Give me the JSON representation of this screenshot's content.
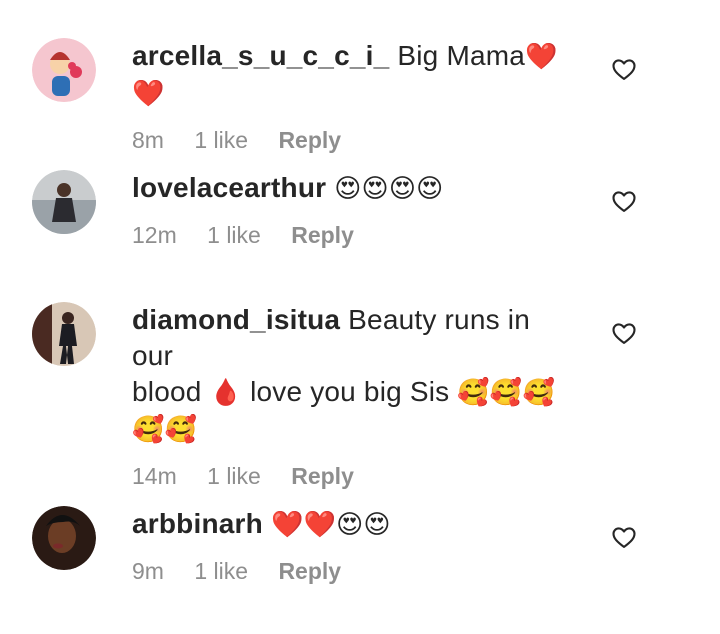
{
  "comments": [
    {
      "username": "arcella_s_u_c_c_i_",
      "text": "Big Mama",
      "emojis": "❤️❤️",
      "time": "8m",
      "likes": "1 like",
      "reply": "Reply",
      "avatar_bg": "#f5c6cf"
    },
    {
      "username": "lovelacearthur",
      "text": "",
      "emojis": "😍😍😍😍",
      "time": "12m",
      "likes": "1 like",
      "reply": "Reply",
      "avatar_bg": "#c9ccce"
    },
    {
      "username": "diamond_isitua",
      "text_line1": "Beauty runs in our",
      "text_line2": "blood",
      "emoji_drop": "🩸",
      "text_line2b": "love you big Sis",
      "emojis_line2": "🥰🥰🥰",
      "emojis_line3": "🥰🥰",
      "time": "14m",
      "likes": "1 like",
      "reply": "Reply",
      "avatar_bg": "#d8c7b6"
    },
    {
      "username": "arbbinarh",
      "text": "",
      "emojis": "❤️❤️😍😍",
      "time": "9m",
      "likes": "1 like",
      "reply": "Reply",
      "avatar_bg": "#2a1a14"
    }
  ],
  "icons": {
    "like": "heart-outline-icon"
  },
  "colors": {
    "text": "#262626",
    "meta": "#8e8e8e",
    "heart": "#e0245e"
  }
}
